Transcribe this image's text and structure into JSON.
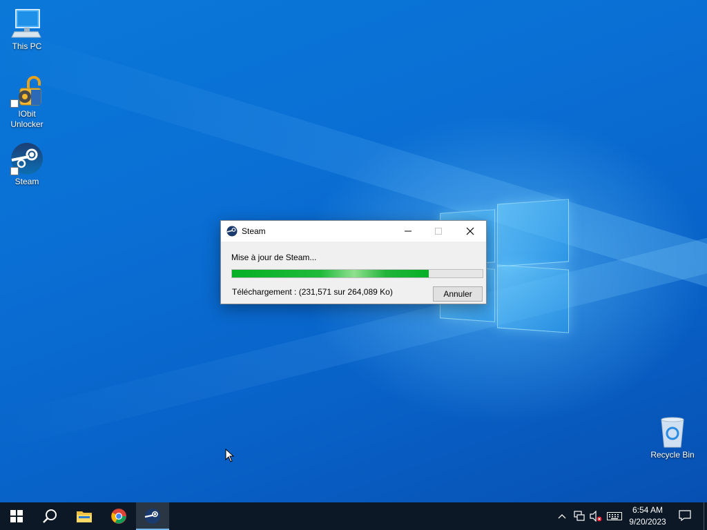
{
  "desktop": {
    "icons": [
      {
        "label": "This PC",
        "icon": "computer-icon"
      },
      {
        "label": "IObit Unlocker",
        "icon": "unlocker-icon"
      },
      {
        "label": "Steam",
        "icon": "steam-icon"
      },
      {
        "label": "Recycle Bin",
        "icon": "recycle-bin-icon"
      }
    ]
  },
  "dialog": {
    "title": "Steam",
    "status": "Mise à jour de Steam...",
    "progress_fraction": 0.785,
    "download_text": "Téléchargement : (231,571 sur 264,089 Ko)",
    "cancel_label": "Annuler"
  },
  "taskbar": {
    "items": [
      "start-icon",
      "search-icon",
      "file-explorer-icon",
      "chrome-icon",
      "steam-icon"
    ],
    "active_item": "steam-icon",
    "tray": {
      "time": "6:54 AM",
      "date": "9/20/2023",
      "icons": [
        "chevron-up-icon",
        "network-icon",
        "volume-muted-icon",
        "keyboard-icon",
        "notification-icon"
      ]
    }
  },
  "colors": {
    "desktop_blue": "#0a6fd4",
    "taskbar": "#0c1825",
    "progress_green": "#06b025",
    "active_underline": "#76b9ed"
  }
}
